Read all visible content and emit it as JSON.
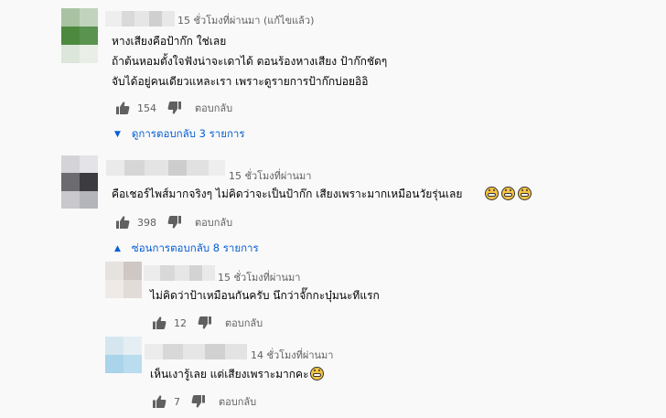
{
  "comments": [
    {
      "time": "15 ชั่วโมงที่ผ่านมา",
      "edited": "(แก้ไขแล้ว)",
      "lines": [
        "หางเสียงคือป้าก๊ก ใช่เลย",
        "ถ้าต้นหอมตั้งใจฟังน่าจะเดาได้ ตอนร้องหางเสียง ป้าก๊กชัดๆ",
        "จับได้อยู่คนเดียวแหละเรา เพราะดูรายการป้าก๊กบ่อยอิอิ"
      ],
      "likes": "154",
      "reply_label": "ตอบกลับ",
      "replies_toggle": "ดูการตอบกลับ 3 รายการ"
    },
    {
      "time": "15 ชั่วโมงที่ผ่านมา",
      "text": "คือเชอร์ไพส์มากจริงๆ ไม่คิดว่าจะเป็นป้าก๊ก  เสียงเพราะมากเหมือนวัยรุ่นเลย",
      "emoji_icon": "grinning-face-icon",
      "likes": "398",
      "reply_label": "ตอบกลับ",
      "replies_toggle": "ซ่อนการตอบกลับ 8 รายการ",
      "replies": [
        {
          "time": "15 ชั่วโมงที่ผ่านมา",
          "text": "ไม่คิดว่าป้าเหมือนกันครับ นึกว่าจั๊กกะบุ๋มนะทีแรก",
          "likes": "12",
          "reply_label": "ตอบกลับ"
        },
        {
          "time": "14 ชั่วโมงที่ผ่านมา",
          "text": "เห็นเงารู้เลย แต่เสียงเพราะมากคะ",
          "likes": "7",
          "reply_label": "ตอบกลับ"
        }
      ]
    }
  ],
  "icons": {
    "like": "thumbs-up-icon",
    "dislike": "thumbs-down-icon",
    "expand": "caret-down-icon",
    "collapse": "caret-up-icon"
  },
  "colors": {
    "link": "#065fd4",
    "meta": "#606060",
    "background": "#f9f9f9"
  }
}
